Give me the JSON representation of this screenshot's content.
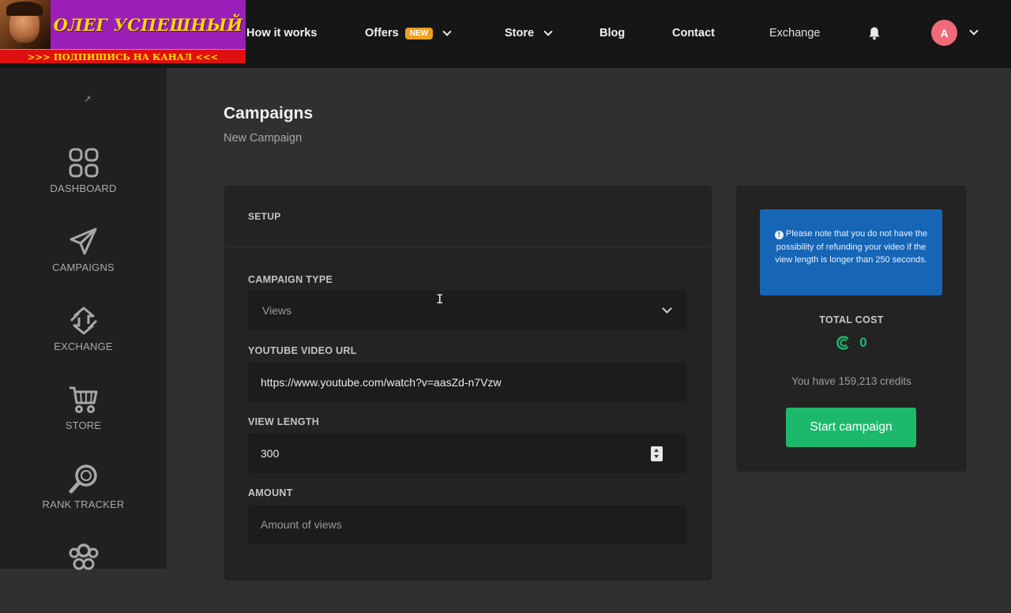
{
  "banner": {
    "title": "ОЛЕГ УСПЕШНЫЙ",
    "subtitle": ">>>  ПОДПИШИСЬ НА КАНАЛ  <<<"
  },
  "nav": {
    "how_it_works": "How it works",
    "offers": "Offers",
    "offers_badge": "NEW",
    "store": "Store",
    "blog": "Blog",
    "contact": "Contact",
    "exchange": "Exchange",
    "avatar_initial": "A"
  },
  "sidebar": {
    "items": [
      {
        "label": "DASHBOARD",
        "icon": "dashboard-icon"
      },
      {
        "label": "CAMPAIGNS",
        "icon": "paper-plane-icon"
      },
      {
        "label": "EXCHANGE",
        "icon": "exchange-icon"
      },
      {
        "label": "STORE",
        "icon": "cart-icon"
      },
      {
        "label": "RANK TRACKER",
        "icon": "magnifier-icon"
      }
    ]
  },
  "page": {
    "title": "Campaigns",
    "subtitle": "New Campaign"
  },
  "form": {
    "section_title": "SETUP",
    "campaign_type_label": "CAMPAIGN TYPE",
    "campaign_type_value": "Views",
    "video_url_label": "YOUTUBE VIDEO URL",
    "video_url_value": "https://www.youtube.com/watch?v=aasZd-n7Vzw",
    "view_length_label": "VIEW LENGTH",
    "view_length_value": "300",
    "amount_label": "AMOUNT",
    "amount_placeholder": "Amount of views"
  },
  "cost_card": {
    "notice": "Please note that you do not have the possibility of refunding your video if the view length is longer than 250 seconds.",
    "total_label": "TOTAL COST",
    "total_value": "0",
    "credits_text": "You have 159,213 credits",
    "start_button": "Start campaign"
  },
  "colors": {
    "accent_green": "#1db96b",
    "notice_blue": "#1766b5",
    "avatar_pink": "#f06a7a",
    "badge_orange": "#f0a020"
  }
}
